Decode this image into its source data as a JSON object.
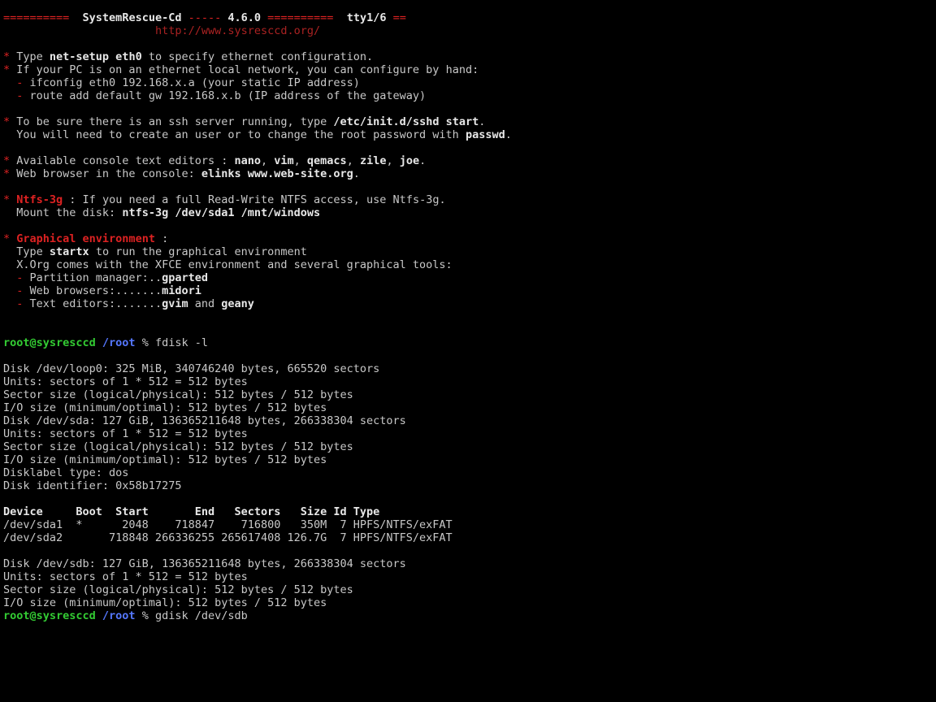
{
  "header": {
    "eq1": "==========  ",
    "title": "SystemRescue-Cd",
    "sep1": " ----- ",
    "version": "4.6.0",
    "sep2": " ========== ",
    "tty": " tty1/6",
    "eq3": " ==",
    "url": "http://www.sysresccd.org/"
  },
  "tips": {
    "star": "* ",
    "dash": "  - ",
    "t1a": "Type ",
    "t1b": "net-setup eth0",
    "t1c": " to specify ethernet configuration.",
    "t2": "If your PC is on an ethernet local network, you can configure by hand:",
    "t2a": "ifconfig eth0 192.168.x.a (your static IP address)",
    "t2b": "route add default gw 192.168.x.b (IP address of the gateway)",
    "t3a": "To be sure there is an ssh server running, type ",
    "t3b": "/etc/init.d/sshd start",
    "t3c": ".",
    "t3d": "  You will need to create an user or to change the root password with ",
    "t3e": "passwd",
    "t3f": ".",
    "t4a": "Available console text editors : ",
    "e1": "nano",
    "comma": ", ",
    "e2": "vim",
    "e3": "qemacs",
    "e4": "zile",
    "e5": "joe",
    "dot": ".",
    "t5a": "Web browser in the console: ",
    "t5b": "elinks www.web-site.org",
    "ntfs_lbl": "Ntfs-3g",
    "ntfs_a": " : If you need a full Read-Write NTFS access, use Ntfs-3g.",
    "ntfs_b": "  Mount the disk: ",
    "ntfs_c": "ntfs-3g /dev/sda1 /mnt/windows",
    "ge_lbl": "Graphical environment",
    "ge_colon": " :",
    "ge_a": "  Type ",
    "ge_b": "startx",
    "ge_c": " to run the graphical environment",
    "ge_d": "  X.Org comes with the XFCE environment and several graphical tools:",
    "pm_a": "Partition manager:..",
    "pm_b": "gparted",
    "wb_a": "Web browsers:.......",
    "wb_b": "midori",
    "te_a": "Text editors:.......",
    "te_b": "gvim",
    "te_c": " and ",
    "te_d": "geany"
  },
  "prompt1": {
    "userhost": "root@sysresccd",
    "path": " /root",
    "sym": " % ",
    "cmd": "fdisk -l"
  },
  "fdisk": {
    "l1": "Disk /dev/loop0: 325 MiB, 340746240 bytes, 665520 sectors",
    "l2": "Units: sectors of 1 * 512 = 512 bytes",
    "l3": "Sector size (logical/physical): 512 bytes / 512 bytes",
    "l4": "I/O size (minimum/optimal): 512 bytes / 512 bytes",
    "l5": "Disk /dev/sda: 127 GiB, 136365211648 bytes, 266338304 sectors",
    "l6": "Units: sectors of 1 * 512 = 512 bytes",
    "l7": "Sector size (logical/physical): 512 bytes / 512 bytes",
    "l8": "I/O size (minimum/optimal): 512 bytes / 512 bytes",
    "l9": "Disklabel type: dos",
    "l10": "Disk identifier: 0x58b17275",
    "hdr": "Device     Boot  Start       End   Sectors   Size Id Type",
    "r1": "/dev/sda1  *      2048    718847    716800   350M  7 HPFS/NTFS/exFAT",
    "r2": "/dev/sda2       718848 266336255 265617408 126.7G  7 HPFS/NTFS/exFAT",
    "b1": "Disk /dev/sdb: 127 GiB, 136365211648 bytes, 266338304 sectors",
    "b2": "Units: sectors of 1 * 512 = 512 bytes",
    "b3": "Sector size (logical/physical): 512 bytes / 512 bytes",
    "b4": "I/O size (minimum/optimal): 512 bytes / 512 bytes"
  },
  "prompt2": {
    "userhost": "root@sysresccd",
    "path": " /root",
    "sym": " % ",
    "cmd": "gdisk /dev/sdb"
  }
}
